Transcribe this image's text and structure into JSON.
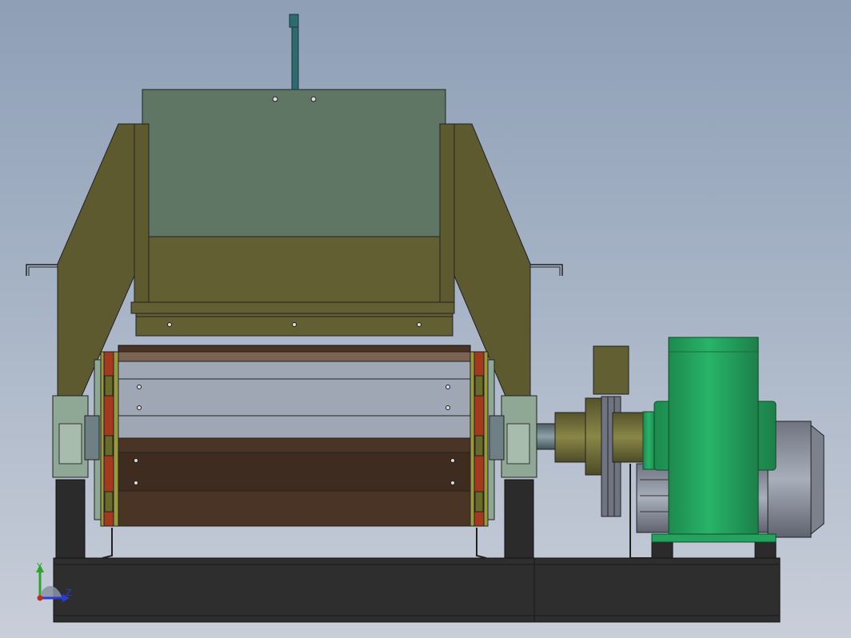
{
  "viewport": {
    "background_top": "#8e9fb6",
    "background_bottom": "#c9ced9"
  },
  "triad": {
    "y_label": "Y",
    "z_label": "Z",
    "y_color": "#2ea32e",
    "z_color": "#2a3bd6",
    "x_color": "#c62828"
  },
  "colors": {
    "hopper": "#5f7665",
    "olive": "#625f32",
    "olive_dark": "#4f4d29",
    "drum_brown": "#4a3426",
    "drum_steel": "#9fa6b4",
    "disc_red": "#a23a1f",
    "disc_yellow": "#9a9a3a",
    "bearing": "#8fa895",
    "frame": "#2e2e2e",
    "motor_green": "#24a35e",
    "motor_gray": "#8a8f9a",
    "shaft": "#6f7f86",
    "lever": "#2f6a6f"
  }
}
